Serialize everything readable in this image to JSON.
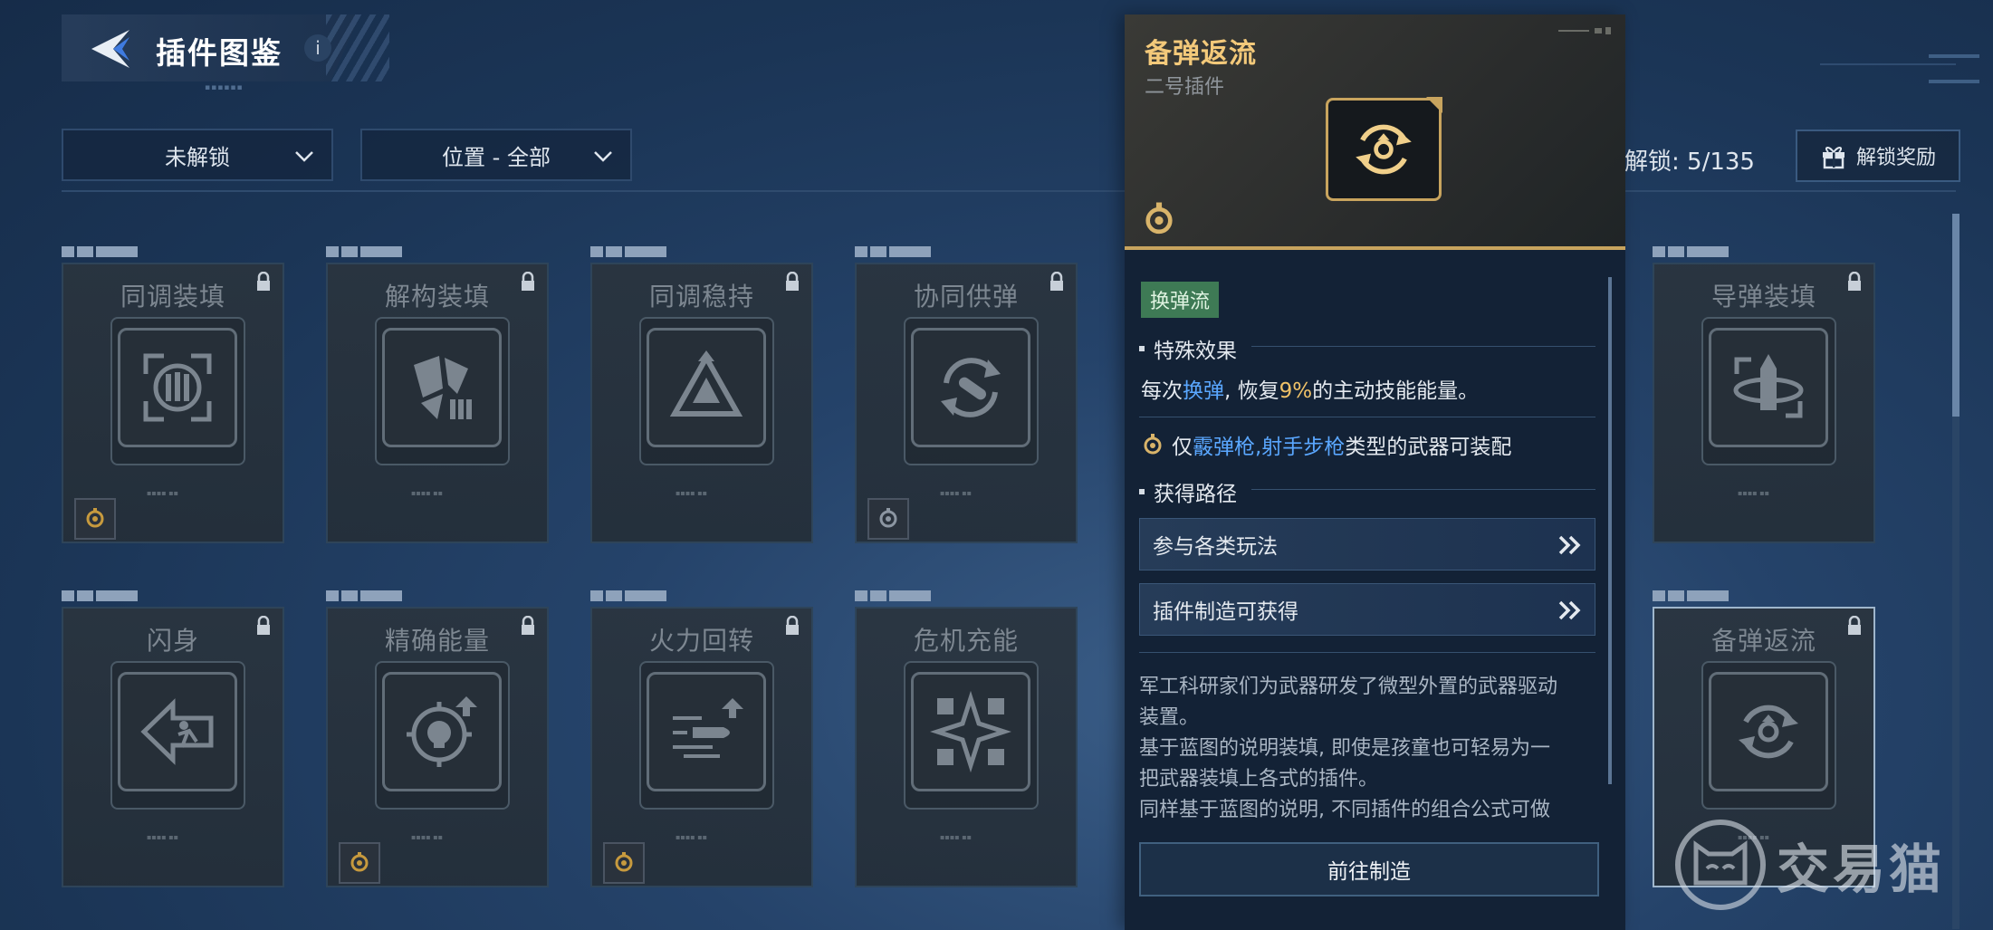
{
  "header": {
    "title": "插件图鉴",
    "info": "i"
  },
  "filters": {
    "status": "未解锁",
    "position": "位置 - 全部"
  },
  "progress": {
    "label": "解锁: 5/135",
    "unlocked": 5,
    "total": 135
  },
  "reward_button": "解锁奖励",
  "cards_row1": [
    {
      "name": "同调装填",
      "locked": true,
      "badge": true
    },
    {
      "name": "解构装填",
      "locked": true,
      "badge": false
    },
    {
      "name": "同调稳持",
      "locked": true,
      "badge": false
    },
    {
      "name": "协同供弹",
      "locked": true,
      "badge": true
    },
    {
      "name": "导弹装填",
      "locked": true,
      "badge": false
    }
  ],
  "cards_row2": [
    {
      "name": "闪身",
      "locked": true,
      "badge": false
    },
    {
      "name": "精确能量",
      "locked": true,
      "badge": true
    },
    {
      "name": "火力回转",
      "locked": true,
      "badge": true
    },
    {
      "name": "危机充能",
      "locked": false,
      "badge": false
    },
    {
      "name": "备弹返流",
      "locked": true,
      "badge": false,
      "selected": true
    }
  ],
  "detail": {
    "title": "备弹返流",
    "subtitle": "二号插件",
    "flow_tag": "换弹流",
    "special_effect_heading": "特殊效果",
    "effect": {
      "p1": "每次",
      "hl1": "换弹",
      "p2": ", 恢复",
      "hl2": "9%",
      "p3": "的主动技能能量。"
    },
    "restriction": {
      "p1": "仅",
      "hl": "霰弹枪,射手步枪",
      "p2": "类型的武器可装配"
    },
    "source_heading": "获得路径",
    "routes": [
      "参与各类玩法",
      "插件制造可获得"
    ],
    "description": [
      "军工科研家们为武器研发了微型外置的武器驱动",
      "装置。",
      "基于蓝图的说明装填, 即使是孩童也可轻易为一",
      "把武器装填上各式的插件。",
      "同样基于蓝图的说明, 不同插件的组合公式可做"
    ],
    "goto_button": "前往制造"
  },
  "watermark": "交易猫",
  "colors": {
    "gold": "#c8a45e",
    "title_gold": "#f3c97a",
    "highlight_blue": "#5aa7ff",
    "highlight_gold": "#f0c268",
    "flow_tag": "#3e7a55"
  }
}
